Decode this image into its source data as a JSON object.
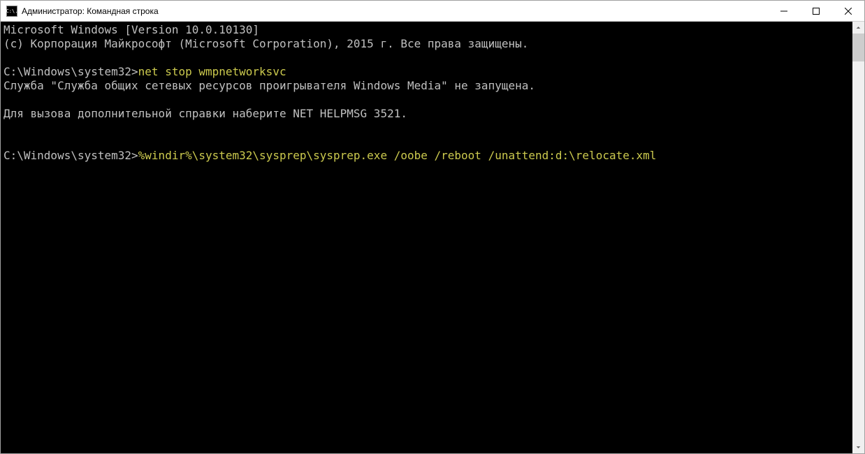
{
  "window": {
    "icon_text": "C:\\.",
    "title": "Администратор: Командная строка"
  },
  "terminal": {
    "lines": {
      "l1": "Microsoft Windows [Version 10.0.10130]",
      "l2": "(c) Корпорация Майкрософт (Microsoft Corporation), 2015 г. Все права защищены.",
      "blank1": "",
      "prompt1": "C:\\Windows\\system32>",
      "cmd1": "net stop wmpnetworksvc",
      "l3": "Служба \"Служба общих сетевых ресурсов проигрывателя Windows Media\" не запущена.",
      "blank2": "",
      "l4": "Для вызова дополнительной справки наберите NET HELPMSG 3521.",
      "blank3": "",
      "blank4": "",
      "prompt2": "C:\\Windows\\system32>",
      "cmd2": "%windir%\\system32\\sysprep\\sysprep.exe /oobe /reboot /unattend:d:\\relocate.xml"
    }
  }
}
